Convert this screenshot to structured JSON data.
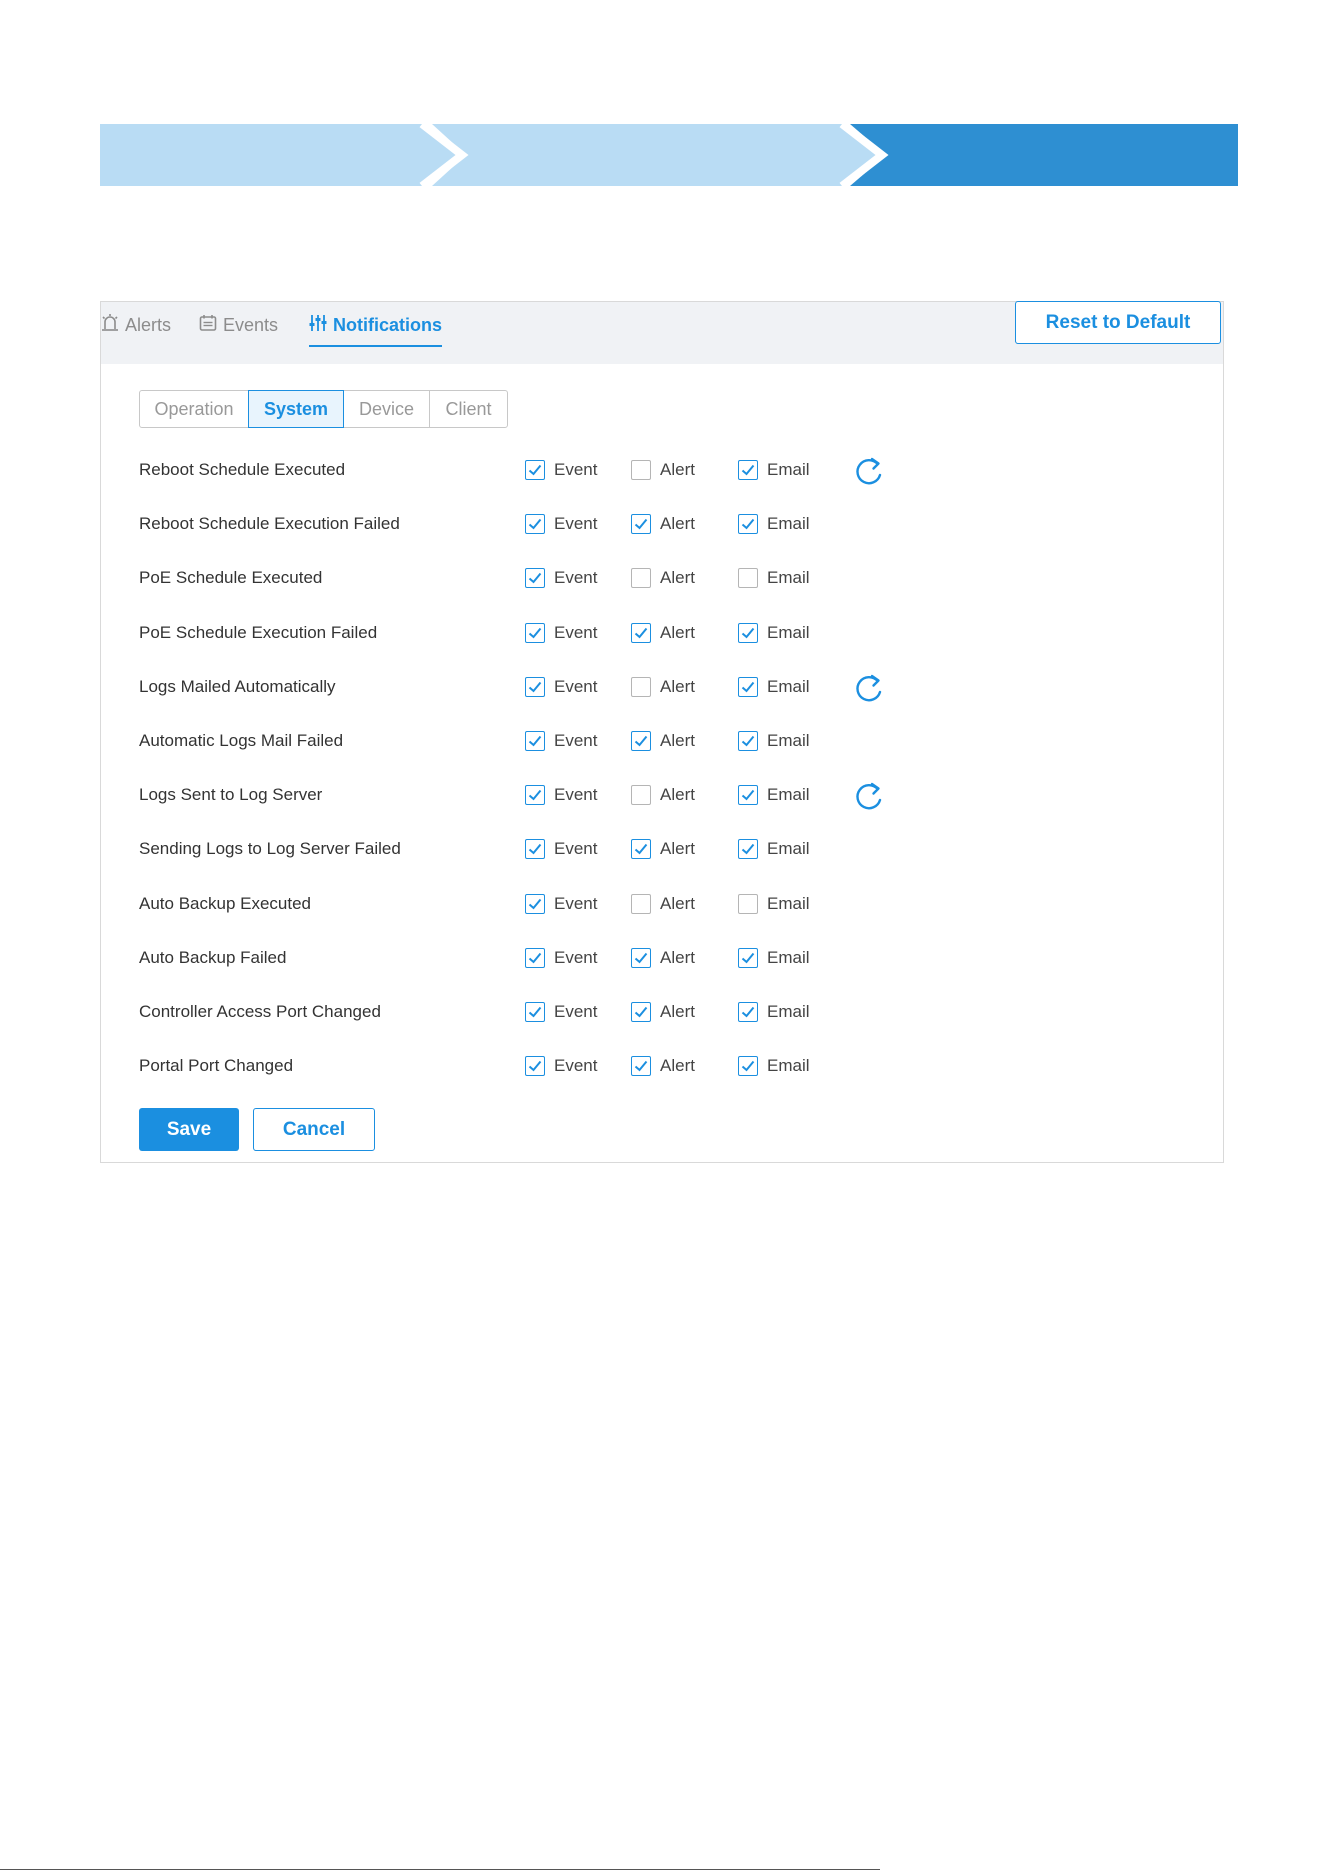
{
  "colors": {
    "accent": "#1b8fe0",
    "banner_light": "#b9dcf4",
    "banner_dark": "#2e8fd2",
    "header_bg": "#f0f2f5"
  },
  "banner": {
    "steps": 3,
    "active_step": 3
  },
  "top_tabs": [
    {
      "label": "Alerts",
      "icon": "alarm-icon",
      "active": false
    },
    {
      "label": "Events",
      "icon": "calendar-icon",
      "active": false
    },
    {
      "label": "Notifications",
      "icon": "sliders-icon",
      "active": true
    }
  ],
  "reset_label": "Reset to Default",
  "sub_tabs": [
    {
      "label": "Operation",
      "active": false
    },
    {
      "label": "System",
      "active": true
    },
    {
      "label": "Device",
      "active": false
    },
    {
      "label": "Client",
      "active": false
    }
  ],
  "option_labels": {
    "event": "Event",
    "alert": "Alert",
    "email": "Email"
  },
  "rows": [
    {
      "label": "Reboot Schedule Executed",
      "event": true,
      "alert": false,
      "email": true,
      "refresh": true
    },
    {
      "label": "Reboot Schedule Execution Failed",
      "event": true,
      "alert": true,
      "email": true,
      "refresh": false
    },
    {
      "label": "PoE Schedule Executed",
      "event": true,
      "alert": false,
      "email": false,
      "refresh": false
    },
    {
      "label": "PoE Schedule Execution Failed",
      "event": true,
      "alert": true,
      "email": true,
      "refresh": false
    },
    {
      "label": "Logs Mailed Automatically",
      "event": true,
      "alert": false,
      "email": true,
      "refresh": true
    },
    {
      "label": "Automatic Logs Mail Failed",
      "event": true,
      "alert": true,
      "email": true,
      "refresh": false
    },
    {
      "label": "Logs Sent to Log Server",
      "event": true,
      "alert": false,
      "email": true,
      "refresh": true
    },
    {
      "label": "Sending Logs to Log Server Failed",
      "event": true,
      "alert": true,
      "email": true,
      "refresh": false
    },
    {
      "label": "Auto Backup Executed",
      "event": true,
      "alert": false,
      "email": false,
      "refresh": false
    },
    {
      "label": "Auto Backup Failed",
      "event": true,
      "alert": true,
      "email": true,
      "refresh": false
    },
    {
      "label": "Controller Access Port Changed",
      "event": true,
      "alert": true,
      "email": true,
      "refresh": false
    },
    {
      "label": "Portal Port Changed",
      "event": true,
      "alert": true,
      "email": true,
      "refresh": false
    }
  ],
  "save_label": "Save",
  "cancel_label": "Cancel"
}
